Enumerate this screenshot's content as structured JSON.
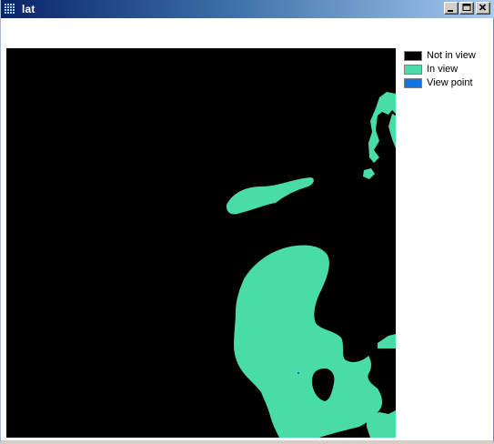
{
  "window": {
    "title": "lat",
    "controls": {
      "minimize": "minimize-icon",
      "maximize": "maximize-icon",
      "close": "close-icon"
    }
  },
  "legend": {
    "items": [
      {
        "label": "Not in view",
        "color": "#000000"
      },
      {
        "label": "In view",
        "color": "#49dca6"
      },
      {
        "label": "View point",
        "color": "#1274e3"
      }
    ]
  },
  "colors": {
    "background": "#000000",
    "in_view": "#49dca6",
    "view_point": "#1274e3",
    "title_bar_start": "#0a246a",
    "title_bar_end": "#a6caf0"
  }
}
